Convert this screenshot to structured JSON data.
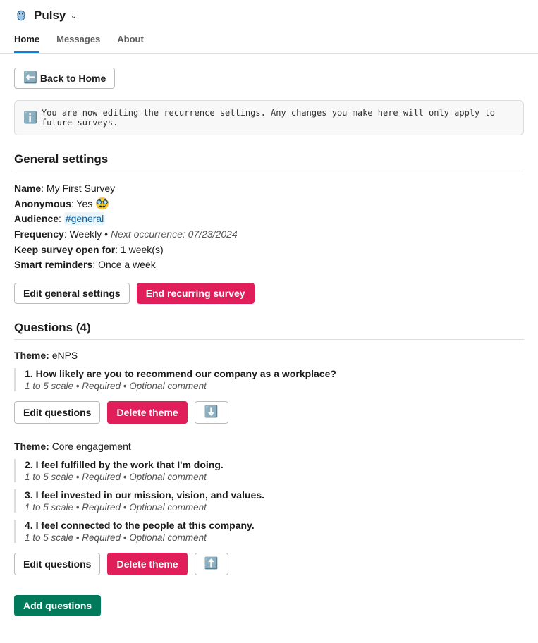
{
  "header": {
    "app_name": "Pulsy"
  },
  "tabs": {
    "home": "Home",
    "messages": "Messages",
    "about": "About"
  },
  "back_button": "Back to Home",
  "info_box": "You are now editing the recurrence settings. Any changes you make here will only apply to future surveys.",
  "general": {
    "title": "General settings",
    "name_label": "Name",
    "name_value": "My First Survey",
    "anon_label": "Anonymous",
    "anon_value": "Yes",
    "audience_label": "Audience",
    "audience_value": "#general",
    "freq_label": "Frequency",
    "freq_value": "Weekly",
    "next_occ": "Next occurrence: 07/23/2024",
    "open_label": "Keep survey open for",
    "open_value": "1 week(s)",
    "reminders_label": "Smart reminders",
    "reminders_value": "Once a week",
    "edit_btn": "Edit general settings",
    "end_btn": "End recurring survey"
  },
  "questions": {
    "title": "Questions (4)",
    "theme_label": "Theme:",
    "meta": "1 to 5 scale • Required • Optional comment",
    "edit_btn": "Edit questions",
    "delete_btn": "Delete theme",
    "add_btn": "Add questions",
    "themes": [
      {
        "name": "eNPS",
        "items": [
          "1. How likely are you to recommend our company as a workplace?"
        ]
      },
      {
        "name": "Core engagement",
        "items": [
          "2. I feel fulfilled by the work that I'm doing.",
          "3. I feel invested in our mission, vision, and values.",
          "4. I feel connected to the people at this company."
        ]
      }
    ]
  }
}
